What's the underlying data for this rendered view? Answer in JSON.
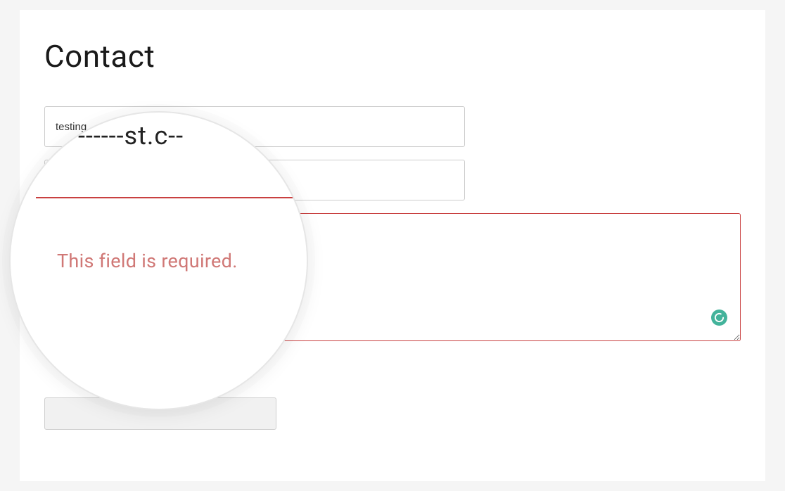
{
  "page": {
    "title": "Contact"
  },
  "fields": {
    "name": {
      "value": "testing",
      "placeholder": ""
    },
    "email": {
      "value": "",
      "placeholder": ""
    },
    "message": {
      "value": "",
      "placeholder": ""
    }
  },
  "validation": {
    "message_error": "This field is required."
  },
  "magnifier": {
    "partial_text": "‑‑‑‑‑‑st.c‑‑",
    "error_text": "This field is required."
  },
  "icons": {
    "grammar": "grammar-check-icon"
  }
}
